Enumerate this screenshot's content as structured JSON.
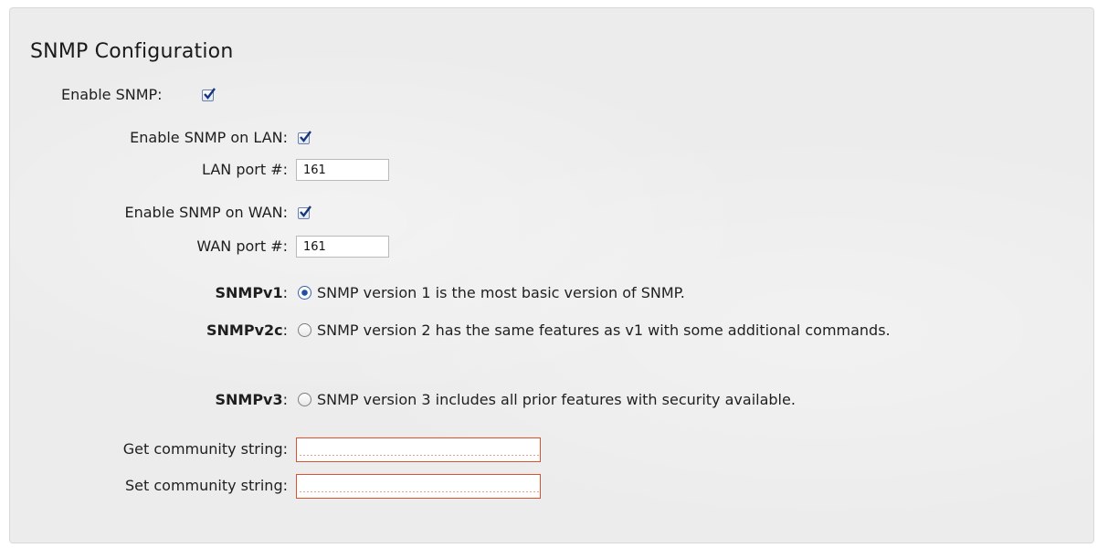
{
  "title": "SNMP Configuration",
  "enable_snmp": {
    "label": "Enable SNMP:",
    "checked": true
  },
  "enable_lan": {
    "label": "Enable SNMP on LAN:",
    "checked": true
  },
  "lan_port": {
    "label": "LAN port #:",
    "value": "161"
  },
  "enable_wan": {
    "label": "Enable SNMP on WAN:",
    "checked": true
  },
  "wan_port": {
    "label": "WAN port #:",
    "value": "161"
  },
  "versions": [
    {
      "label": "SNMPv1",
      "colon": ":",
      "description": "SNMP version 1 is the most basic version of SNMP.",
      "selected": true
    },
    {
      "label": "SNMPv2c",
      "colon": ":",
      "description": "SNMP version 2 has the same features as v1 with some additional commands.",
      "selected": false
    },
    {
      "label": "SNMPv3",
      "colon": ":",
      "description": "SNMP version 3 includes all prior features with security available.",
      "selected": false
    }
  ],
  "get_community": {
    "label": "Get community string:",
    "value": ""
  },
  "set_community": {
    "label": "Set community string:",
    "value": ""
  },
  "colors": {
    "invalid_border": "#d9532f",
    "radio_selected": "#234f9e",
    "panel_bg": "#ececec"
  }
}
